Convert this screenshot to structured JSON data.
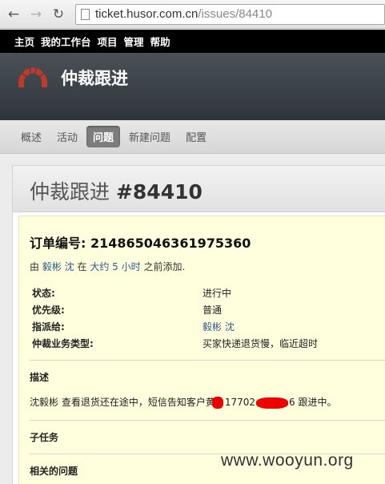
{
  "browser": {
    "url_host": "ticket.husor.com.cn",
    "url_path": "/issues/84410"
  },
  "top_menu": [
    "主页",
    "我的工作台",
    "项目",
    "管理",
    "帮助"
  ],
  "project": {
    "title": "仲裁跟进"
  },
  "tabs": [
    {
      "label": "概述",
      "active": false
    },
    {
      "label": "活动",
      "active": false
    },
    {
      "label": "问题",
      "active": true
    },
    {
      "label": "新建问题",
      "active": false
    },
    {
      "label": "配置",
      "active": false
    }
  ],
  "issue": {
    "title_prefix": "仲裁跟进",
    "number": "#84410",
    "order_label": "订单编号:",
    "order_number": "2148650463619 75360",
    "added_by_prefix": "由",
    "author": "毅彬 沈",
    "added_in": "在",
    "time_ago": "大约 5 小时",
    "added_suffix": "之前添加.",
    "attributes": [
      {
        "label": "状态:",
        "value": "进行中",
        "link": false
      },
      {
        "label": "优先级:",
        "value": "普通",
        "link": false
      },
      {
        "label": "指派给:",
        "value": "毅彬 沈",
        "link": true
      },
      {
        "label": "仲裁业务类型:",
        "value": "买家快递退货慢，临近超时",
        "link": false
      }
    ],
    "description_title": "描述",
    "description_start": "沈毅彬 查看退货还在途中，短信告知客户黄",
    "description_phone": "17702",
    "description_end": "6 跟进中。",
    "subtasks_title": "子任务",
    "related_title": "相关的问题"
  },
  "watermark": "www.wooyun.org",
  "colors": {
    "redaction": "#e00000",
    "link": "#2a5a8a",
    "active_tab": "#7d7d7d"
  }
}
